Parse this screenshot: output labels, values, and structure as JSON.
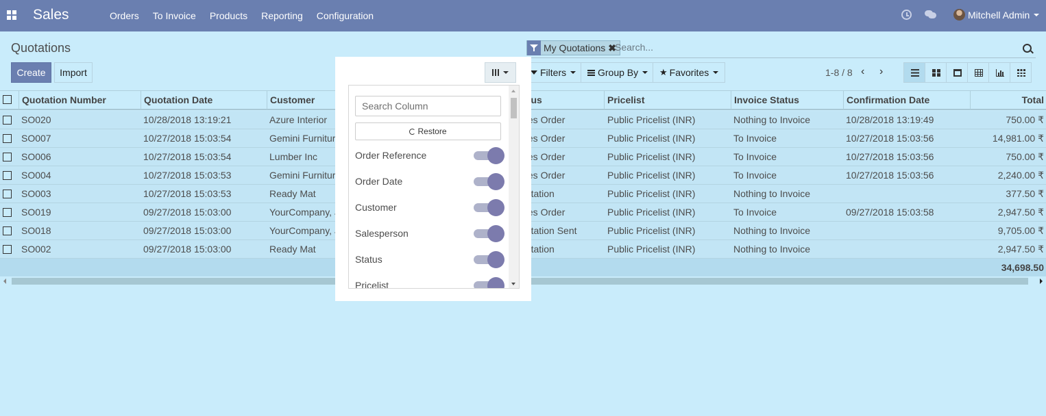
{
  "nav": {
    "app_name": "Sales",
    "menu": [
      "Orders",
      "To Invoice",
      "Products",
      "Reporting",
      "Configuration"
    ],
    "user_name": "Mitchell Admin",
    "icons": [
      "apps-icon",
      "clock-icon",
      "chat-icon"
    ]
  },
  "page": {
    "title": "Quotations",
    "create_label": "Create",
    "import_label": "Import"
  },
  "search": {
    "facet": "My Quotations",
    "facet_close": "✖",
    "placeholder": "Search..."
  },
  "controls": {
    "filters": "Filters",
    "group_by": "Group By",
    "favorites": "Favorites",
    "pager": "1-8 / 8",
    "views": [
      "list",
      "kanban",
      "calendar",
      "pivot",
      "graph",
      "grid"
    ]
  },
  "table": {
    "headers": [
      "Quotation Number",
      "Quotation Date",
      "Customer",
      "Status",
      "Pricelist",
      "Invoice Status",
      "Confirmation Date",
      "Total"
    ],
    "rows": [
      [
        "SO020",
        "10/28/2018 13:19:21",
        "Azure Interior",
        "ales Order",
        "Public Pricelist (INR)",
        "Nothing to Invoice",
        "10/28/2018 13:19:49",
        "750.00 ₹"
      ],
      [
        "SO007",
        "10/27/2018 15:03:54",
        "Gemini Furniture",
        "ales Order",
        "Public Pricelist (INR)",
        "To Invoice",
        "10/27/2018 15:03:56",
        "14,981.00 ₹"
      ],
      [
        "SO006",
        "10/27/2018 15:03:54",
        "Lumber Inc",
        "ales Order",
        "Public Pricelist (INR)",
        "To Invoice",
        "10/27/2018 15:03:56",
        "750.00 ₹"
      ],
      [
        "SO004",
        "10/27/2018 15:03:53",
        "Gemini Furniture",
        "ales Order",
        "Public Pricelist (INR)",
        "To Invoice",
        "10/27/2018 15:03:56",
        "2,240.00 ₹"
      ],
      [
        "SO003",
        "10/27/2018 15:03:53",
        "Ready Mat",
        "uotation",
        "Public Pricelist (INR)",
        "Nothing to Invoice",
        "",
        "377.50 ₹"
      ],
      [
        "SO019",
        "09/27/2018 15:03:00",
        "YourCompany, Joel",
        "ales Order",
        "Public Pricelist (INR)",
        "To Invoice",
        "09/27/2018 15:03:58",
        "2,947.50 ₹"
      ],
      [
        "SO018",
        "09/27/2018 15:03:00",
        "YourCompany, Joel",
        "uotation Sent",
        "Public Pricelist (INR)",
        "Nothing to Invoice",
        "",
        "9,705.00 ₹"
      ],
      [
        "SO002",
        "09/27/2018 15:03:00",
        "Ready Mat",
        "uotation",
        "Public Pricelist (INR)",
        "Nothing to Invoice",
        "",
        "2,947.50 ₹"
      ]
    ],
    "total_sum": "34,698.50"
  },
  "column_dropdown": {
    "search_placeholder": "Search Column",
    "restore_label": "Restore",
    "items": [
      {
        "label": "Order Reference",
        "enabled": true
      },
      {
        "label": "Order Date",
        "enabled": true
      },
      {
        "label": "Customer",
        "enabled": true
      },
      {
        "label": "Salesperson",
        "enabled": true
      },
      {
        "label": "Status",
        "enabled": true
      },
      {
        "label": "Pricelist",
        "enabled": true
      }
    ]
  },
  "colors": {
    "navbar": "#6a7fb0",
    "background": "#c9ecfb",
    "toggle_knob": "#7c7bad"
  }
}
